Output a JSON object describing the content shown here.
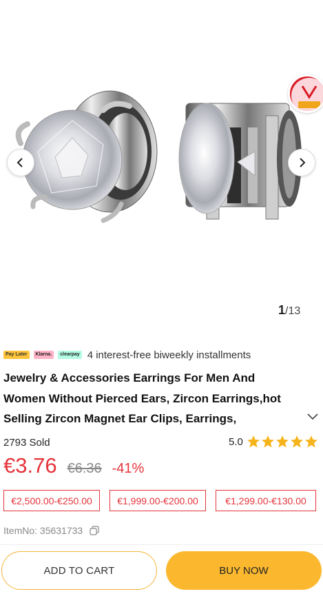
{
  "gallery": {
    "current": "1",
    "total": "/13",
    "badge_text": "Vogdue"
  },
  "payment": {
    "logos": [
      "Pay Later",
      "Klarna.",
      "clearpay"
    ],
    "text": "4 interest-free biweekly installments"
  },
  "product": {
    "title": "Jewelry & Accessories Earrings For Men And Women Without Pierced Ears, Zircon Earrings,hot Selling Zircon Magnet Ear Clips, Earrings,",
    "sold": "2793 Sold",
    "rating": "5.0",
    "stars": 5,
    "price": "€3.76",
    "old_price": "€6.36",
    "discount": "-41%",
    "coupons": [
      "€2,500.00-€250.00",
      "€1,999.00-€200.00",
      "€1,299.00-€130.00"
    ],
    "item_no": "ItemNo: 35631733"
  },
  "actions": {
    "add_to_cart": "ADD TO CART",
    "buy_now": "BUY NOW"
  },
  "colors": {
    "price_red": "#e5333a",
    "buy_yellow": "#fbb82e",
    "star": "#f6b41c"
  }
}
